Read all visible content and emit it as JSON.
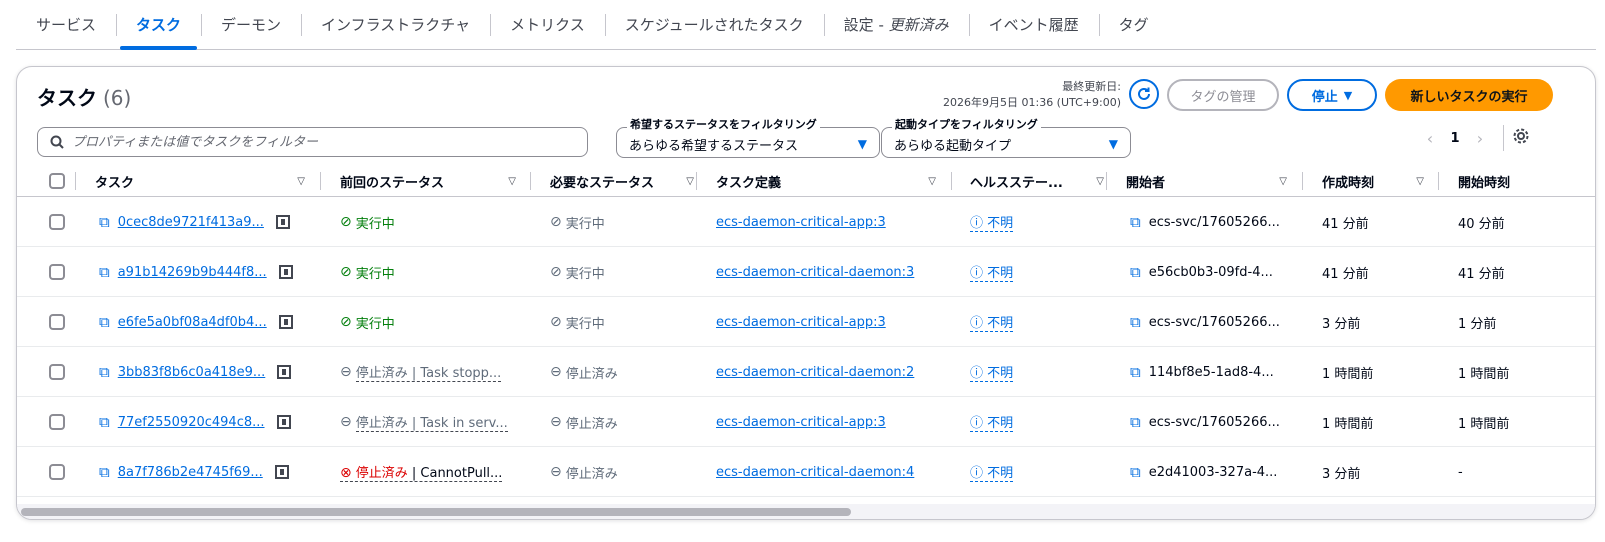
{
  "tabs": [
    {
      "label": "サービス"
    },
    {
      "label": "タスク",
      "active": true
    },
    {
      "label": "デーモン"
    },
    {
      "label": "インフラストラクチャ"
    },
    {
      "label": "メトリクス"
    },
    {
      "label": "スケジュールされたタスク"
    },
    {
      "label": "設定 - ",
      "suffix": "更新済み"
    },
    {
      "label": "イベント履歴"
    },
    {
      "label": "タグ"
    }
  ],
  "panel": {
    "title": "タスク",
    "count": "(6)",
    "updated_label": "最終更新日:",
    "updated_value": "2026年9月5日 01:36 (UTC+9:00)",
    "manage_tags": "タグの管理",
    "stop": "停止",
    "run_new": "新しいタスクの実行"
  },
  "filters": {
    "search_placeholder": "プロパティまたは値でタスクをフィルター",
    "desired_label": "希望するステータスをフィルタリング",
    "desired_value": "あらゆる希望するステータス",
    "launch_label": "起動タイプをフィルタリング",
    "launch_value": "あらゆる起動タイプ"
  },
  "pagination": {
    "page": "1"
  },
  "columns": [
    "タスク",
    "前回のステータス",
    "必要なステータス",
    "タスク定義",
    "ヘルスステー...",
    "開始者",
    "作成時刻",
    "開始時刻"
  ],
  "rows": [
    {
      "task": "0cec8de9721f413a9...",
      "last_status": "実行中",
      "last_kind": "ok",
      "desired": "実行中",
      "desired_kind": "running",
      "taskdef": "ecs-daemon-critical-app:3",
      "health": "不明",
      "started_by": "ecs-svc/17605266...",
      "created": "41 分前",
      "started": "40 分前"
    },
    {
      "task": "a91b14269b9b444f8...",
      "last_status": "実行中",
      "last_kind": "ok",
      "desired": "実行中",
      "desired_kind": "running",
      "taskdef": "ecs-daemon-critical-daemon:3",
      "health": "不明",
      "started_by": "e56cb0b3-09fd-4...",
      "created": "41 分前",
      "started": "41 分前"
    },
    {
      "task": "e6fe5a0bf08a4df0b4...",
      "last_status": "実行中",
      "last_kind": "ok",
      "desired": "実行中",
      "desired_kind": "running",
      "taskdef": "ecs-daemon-critical-app:3",
      "health": "不明",
      "started_by": "ecs-svc/17605266...",
      "created": "3 分前",
      "started": "1 分前"
    },
    {
      "task": "3bb83f8b6c0a418e9...",
      "last_status": "停止済み | Task stopp...",
      "last_kind": "stopped",
      "desired": "停止済み",
      "desired_kind": "stopped",
      "taskdef": "ecs-daemon-critical-daemon:2",
      "health": "不明",
      "started_by": "114bf8e5-1ad8-4...",
      "created": "1 時間前",
      "started": "1 時間前"
    },
    {
      "task": "77ef2550920c494c8...",
      "last_status": "停止済み | Task in serv...",
      "last_kind": "stopped",
      "desired": "停止済み",
      "desired_kind": "stopped",
      "taskdef": "ecs-daemon-critical-app:3",
      "health": "不明",
      "started_by": "ecs-svc/17605266...",
      "created": "1 時間前",
      "started": "1 時間前"
    },
    {
      "task": "8a7f786b2e4745f69...",
      "last_status": "停止済み",
      "last_status_suffix": " | CannotPull...",
      "last_kind": "error",
      "desired": "停止済み",
      "desired_kind": "stopped",
      "taskdef": "ecs-daemon-critical-daemon:4",
      "health": "不明",
      "started_by": "e2d41003-327a-4...",
      "created": "3 分前",
      "started": "-"
    }
  ],
  "colors": {
    "accent": "#006ce0",
    "run_button": "#ff9900",
    "ok": "#037f0c",
    "error": "#db0000"
  }
}
